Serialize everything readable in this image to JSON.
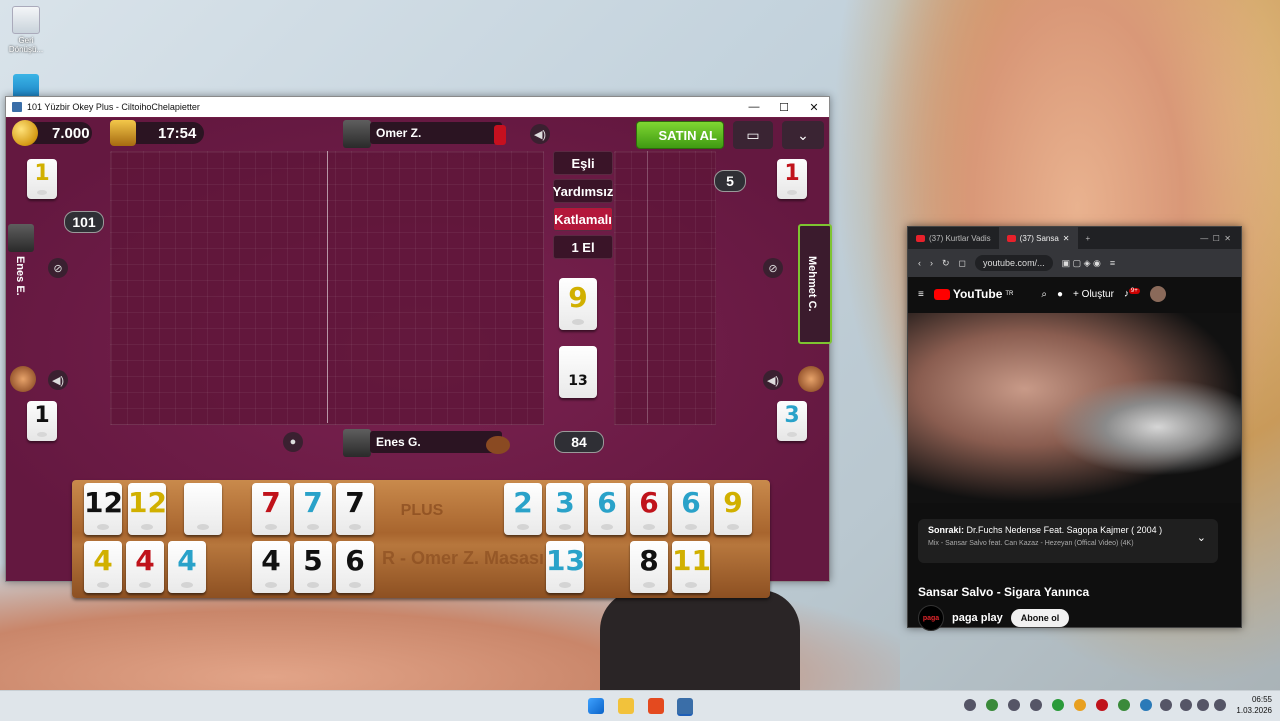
{
  "desktop": {
    "recycle_bin_label": "Geri Dönüşü...",
    "second_icon_label": ""
  },
  "game_window": {
    "title": "101 Yüzbir Okey Plus - CiltoihoChelapietter",
    "controls": {
      "minimize": "—",
      "maximize": "☐",
      "close": "✕"
    },
    "coins": "7.000",
    "timer": "17:54",
    "top_player": "Omer Z.",
    "bottom_player": "Enes G.",
    "left_player": "Enes E.",
    "right_player": "Mehmet C.",
    "buy_button": "SATIN AL",
    "modes": [
      "Eşli",
      "Yardımsız",
      "Katlamalı",
      "1 El"
    ],
    "active_mode_index": 2,
    "left_top_tile": {
      "value": "1",
      "color": "#d1b000"
    },
    "left_bottom_tile": {
      "value": "1",
      "color": "#111111"
    },
    "right_top_tile": {
      "value": "1",
      "color": "#c0131b"
    },
    "right_bottom_tile": {
      "value": "3",
      "color": "#2aa2c9"
    },
    "left_counter": "101",
    "right_counter": "5",
    "center_tile": {
      "value": "9",
      "color": "#d1b000"
    },
    "deck_tile_count": "13",
    "remaining_count": "84",
    "rack_watermark": "R - Omer Z. Masası",
    "rack_logo": "PLUS",
    "rack_row1": [
      {
        "value": "12",
        "color": "#111111"
      },
      {
        "value": "12",
        "color": "#d1b000"
      },
      {
        "value": "",
        "color": "#111111"
      },
      {
        "value": "7",
        "color": "#c0131b"
      },
      {
        "value": "7",
        "color": "#2aa2c9"
      },
      {
        "value": "7",
        "color": "#111111"
      },
      {
        "value": "2",
        "color": "#2aa2c9"
      },
      {
        "value": "3",
        "color": "#2aa2c9"
      },
      {
        "value": "6",
        "color": "#2aa2c9"
      },
      {
        "value": "6",
        "color": "#c0131b"
      },
      {
        "value": "6",
        "color": "#2aa2c9"
      },
      {
        "value": "9",
        "color": "#d1b000"
      }
    ],
    "rack_row2": [
      {
        "value": "4",
        "color": "#d1b000"
      },
      {
        "value": "4",
        "color": "#c0131b"
      },
      {
        "value": "4",
        "color": "#2aa2c9"
      },
      {
        "value": "4",
        "color": "#111111"
      },
      {
        "value": "5",
        "color": "#111111"
      },
      {
        "value": "6",
        "color": "#111111"
      },
      {
        "value": "13",
        "color": "#2aa2c9"
      },
      {
        "value": "8",
        "color": "#111111"
      },
      {
        "value": "11",
        "color": "#d1b000"
      }
    ]
  },
  "browser": {
    "tabs": [
      "(37) Kurtlar Vadis",
      "(37) Sansa"
    ],
    "new_tab": "+",
    "address": "youtube.com/...",
    "yt_logo": "YouTube",
    "yt_region": "TR",
    "create_button": "Oluştur",
    "notif_badge": "9+",
    "next_label": "Sonraki:",
    "next_title": "Dr.Fuchs Nedense Feat. Sagopa Kajmer ( 2004 )",
    "mix_title": "Mix - Sansar Salvo feat. Can Kazaz - Hezeyan (Offical Video) (4K)",
    "video_title": "Sansar Salvo - Sigara Yanınca",
    "channel_name": "paga play",
    "channel_avatar_text": "paga",
    "subscribe_button": "Abone ol"
  },
  "taskbar": {
    "time": "06:55",
    "date": "1.03.2026"
  }
}
